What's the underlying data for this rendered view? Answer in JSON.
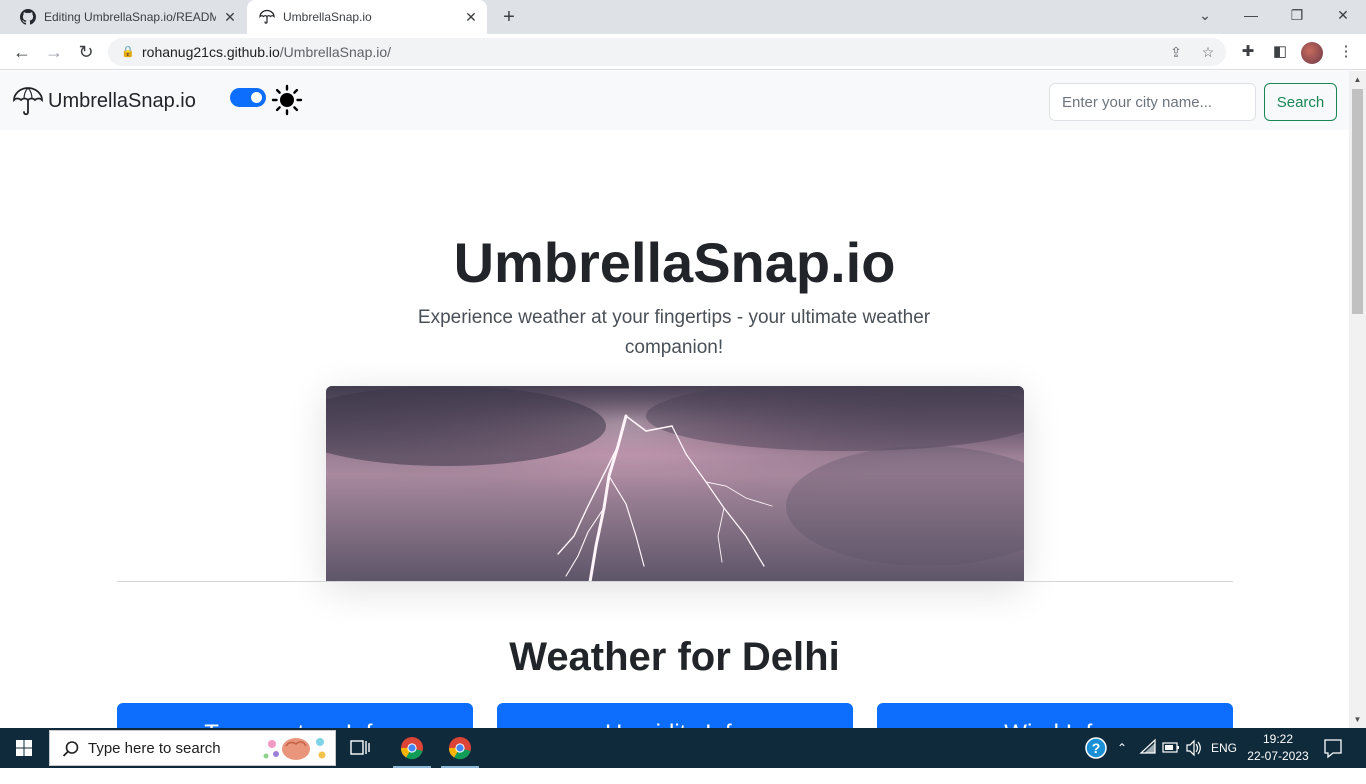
{
  "browser": {
    "tabs": [
      {
        "title": "Editing UmbrellaSnap.io/README"
      },
      {
        "title": "UmbrellaSnap.io"
      }
    ],
    "url_host": "rohanug21cs.github.io",
    "url_path": "/UmbrellaSnap.io/"
  },
  "navbar": {
    "brand": "UmbrellaSnap.io",
    "dark_mode_toggle_on": true,
    "city_placeholder": "Enter your city name...",
    "search_label": "Search"
  },
  "hero": {
    "title": "UmbrellaSnap.io",
    "subtitle": "Experience weather at your fingertips - your ultimate weather companion!"
  },
  "weather": {
    "heading": "Weather for Delhi",
    "cards": [
      {
        "title": "Temperature Info"
      },
      {
        "title": "Humidity Info"
      },
      {
        "title": "Wind Info"
      }
    ]
  },
  "taskbar": {
    "search_placeholder": "Type here to search",
    "language": "ENG",
    "time": "19:22",
    "date": "22-07-2023"
  },
  "colors": {
    "primary": "#0d6efd",
    "success": "#198754",
    "taskbar": "#0f2a3a"
  }
}
